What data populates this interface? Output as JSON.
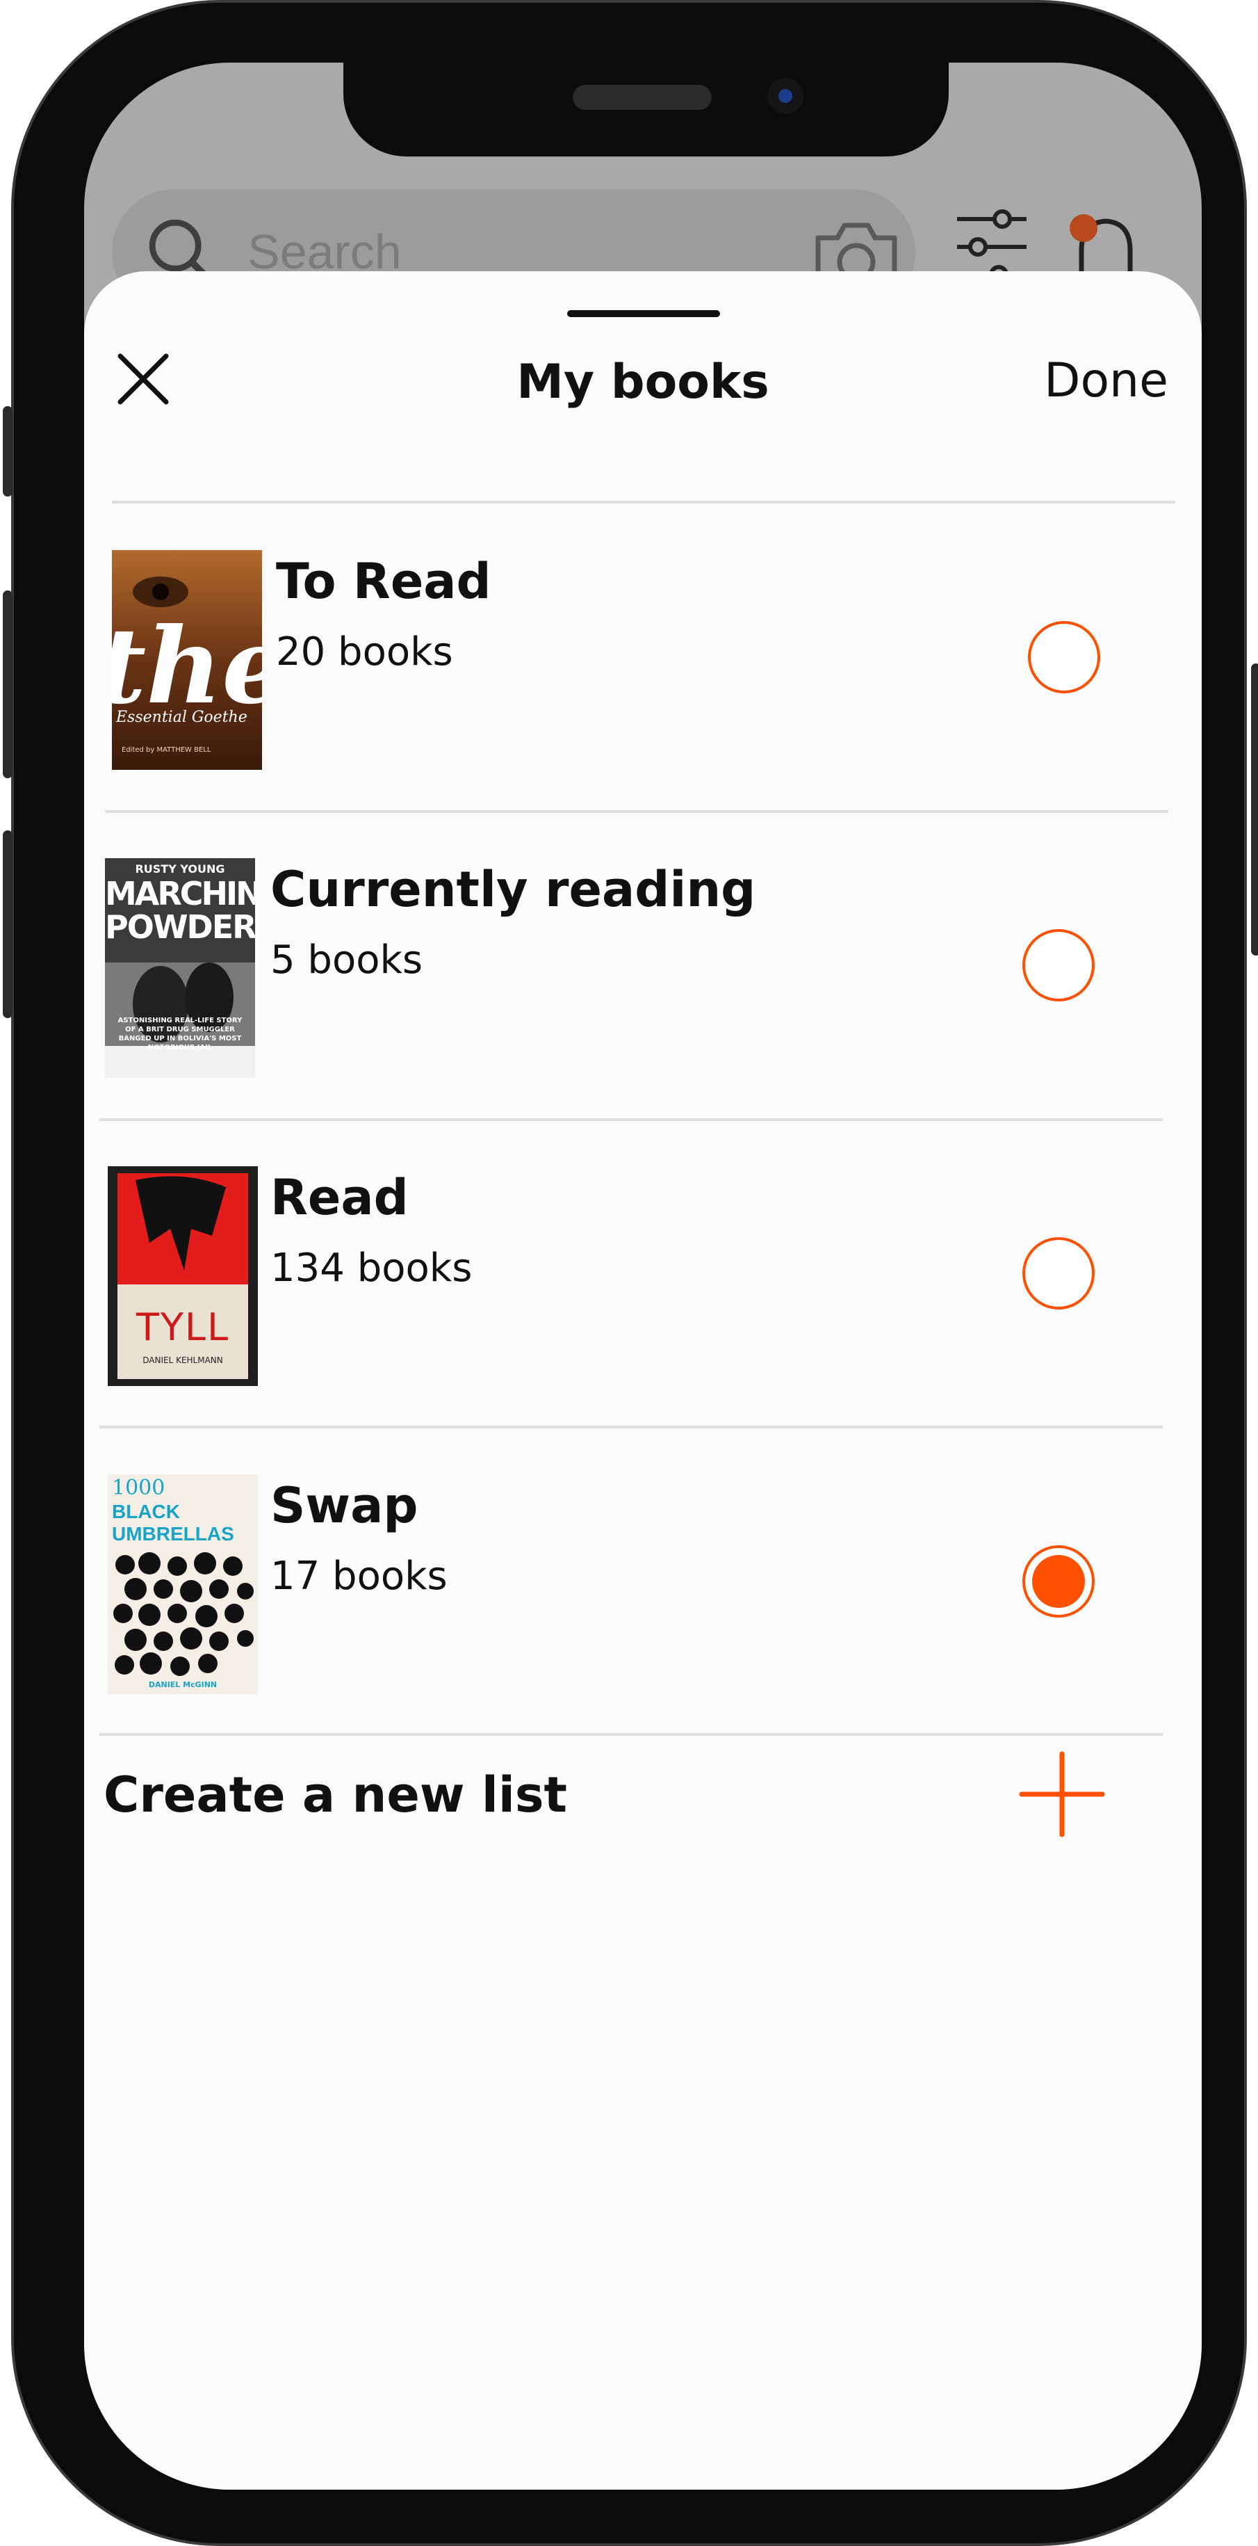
{
  "search": {
    "placeholder": "Search"
  },
  "sheet": {
    "title": "My books",
    "done_label": "Done"
  },
  "lists": [
    {
      "title": "To Read",
      "count": "20 books",
      "selected": false
    },
    {
      "title": "Currently reading",
      "count": "5 books",
      "selected": false
    },
    {
      "title": "Read",
      "count": "134 books",
      "selected": false
    },
    {
      "title": "Swap",
      "count": "17 books",
      "selected": true
    }
  ],
  "covers": {
    "to_read": {
      "big_text": "the",
      "line1": "Essential Goethe",
      "line2": "Edited by MATTHEW BELL"
    },
    "currently_reading": {
      "author": "RUSTY YOUNG",
      "title1": "MARCHING",
      "title2": "POWDER",
      "blurb1": "ASTONISHING REAL-LIFE STORY",
      "blurb2": "OF A BRIT DRUG SMUGGLER",
      "blurb3": "BANGED UP IN BOLIVIA'S MOST",
      "blurb4": "NOTORIOUS JAIL"
    },
    "read": {
      "title": "TYLL",
      "author": "DANIEL KEHLMANN"
    },
    "swap": {
      "t1": "1000",
      "t2": "BLACK",
      "t3": "UMBRELLAS",
      "author": "DANIEL McGINN"
    }
  },
  "create": {
    "label": "Create a new list"
  },
  "colors": {
    "accent": "#ff5000",
    "background": "#fbfbfb",
    "text": "#111111"
  }
}
